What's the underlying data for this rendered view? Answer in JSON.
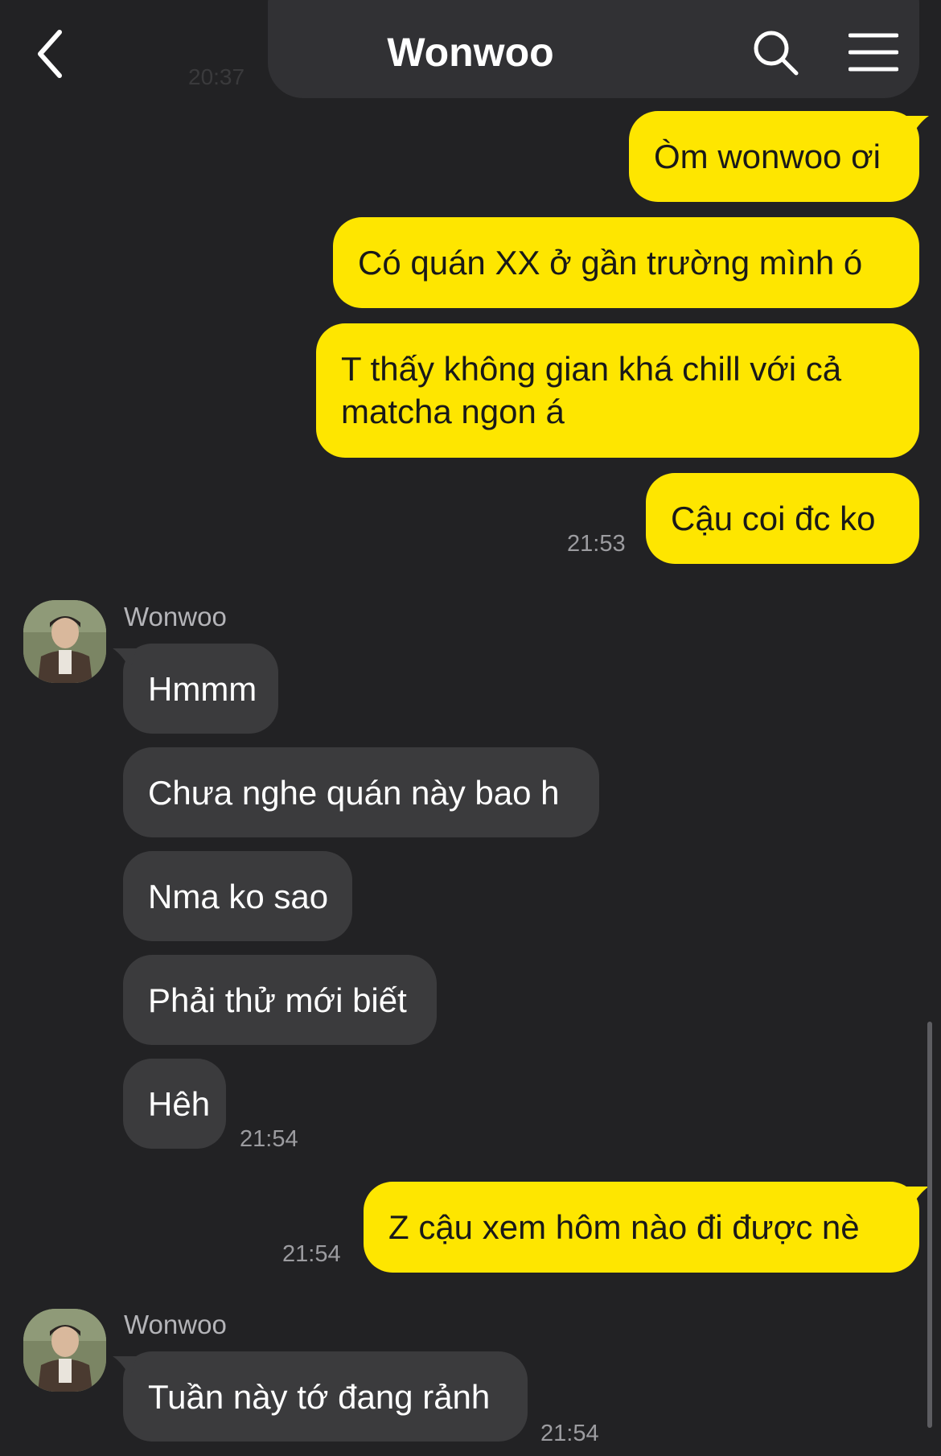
{
  "header": {
    "title": "Wonwoo",
    "faded_time": "20:37",
    "icons": [
      "back-icon",
      "search-icon",
      "menu-icon"
    ]
  },
  "colors": {
    "background": "#222224",
    "outgoing_bubble": "#fee600",
    "incoming_bubble": "#3b3b3d",
    "header_bar": "#313134"
  },
  "messages": {
    "m1": "Òm wonwoo ơi",
    "m2": "Có quán XX ở gần trường mình ó",
    "m3": "T thấy không gian khá chill với cả matcha ngon á",
    "m4": "Cậu coi đc ko",
    "t1": "21:53",
    "sender1": "Wonwoo",
    "r1": "Hmmm",
    "r2": "Chưa nghe quán này bao h",
    "r3": "Nma ko sao",
    "r4": "Phải thử mới biết",
    "r5": "Hêh",
    "t2": "21:54",
    "m5": "Z cậu xem hôm nào đi được nè",
    "t3": "21:54",
    "sender2": "Wonwoo",
    "r6": "Tuần này tớ đang rảnh",
    "t4": "21:54"
  }
}
